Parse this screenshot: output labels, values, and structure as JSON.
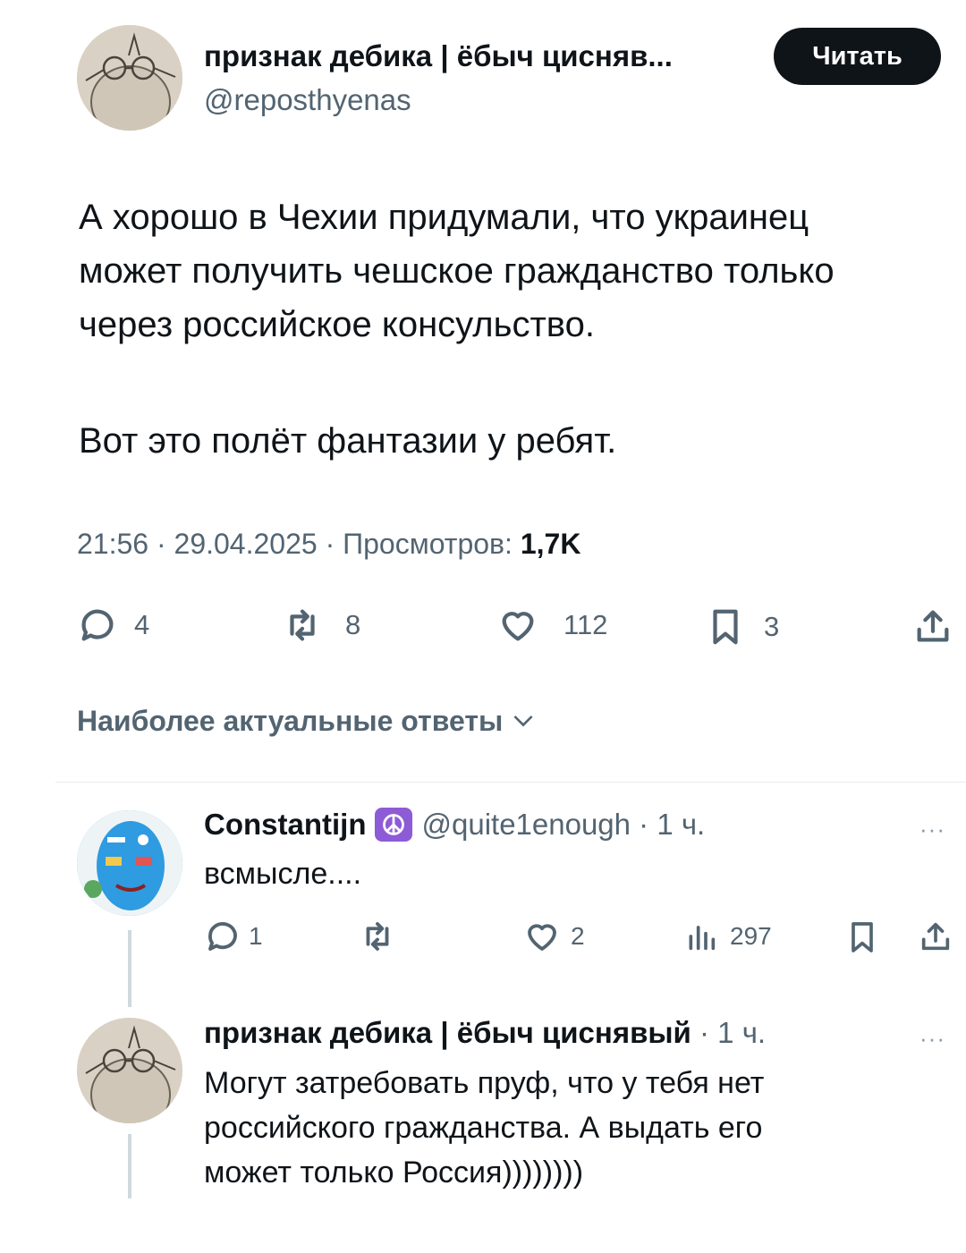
{
  "tweet": {
    "author_name": "признак дебика | ёбыч цисняв...",
    "author_handle": "@reposthyenas",
    "follow_label": "Читать",
    "text_lines": [
      "А хорошо в Чехии придумали, что украинец",
      "может получить чешское гражданство только",
      "через российское консульство.",
      "Вот это полёт фантазии у ребят."
    ],
    "time": "21:56",
    "date": "29.04.2025",
    "views_label": "Просмотров:",
    "views": "1,7K",
    "separator": "·",
    "actions": {
      "replies": "4",
      "reposts": "8",
      "likes": "112",
      "bookmarks": "3"
    }
  },
  "replies_sort_label": "Наиболее актуальные ответы",
  "replies": [
    {
      "author_name": "Constantijn",
      "handle_time": "@quite1enough · 1 ч.",
      "text": "всмысле....",
      "actions": {
        "replies": "1",
        "likes": "2",
        "views": "297"
      },
      "more": "···"
    },
    {
      "author_name": "признак дебика | ёбыч цисня­вый",
      "time": "· 1 ч.",
      "text_lines": [
        "Могут затребовать пруф, что у тебя нет",
        "российского гражданства. А выдать его",
        "может только Россия))))))))"
      ],
      "more": "···"
    }
  ],
  "icons": {
    "reply": "comment-icon",
    "repost": "repost-icon",
    "like": "heart-icon",
    "bookmark": "bookmark-icon",
    "share": "share-icon",
    "views": "analytics-icon",
    "peace": "peace-icon"
  },
  "colors": {
    "text": "#0f1419",
    "muted": "#536471",
    "button_bg": "#0f1419",
    "badge": "#8e5bd6"
  }
}
